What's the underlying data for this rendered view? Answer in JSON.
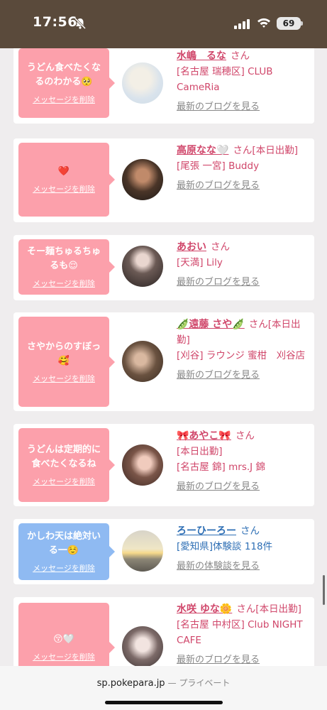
{
  "status_bar": {
    "time": "17:56",
    "battery": "69"
  },
  "cards": [
    {
      "message": "うどん食べたくなるのわかる🥺",
      "delete_label": "メッセージを削除",
      "name": "水嶋　るな",
      "suffix": "さん",
      "shop": "[名古屋 瑞穂区] CLUB CameRia",
      "blog": "最新のブログを見る",
      "bubble_color": "#fca0ab"
    },
    {
      "message": "❤️",
      "delete_label": "メッセージを削除",
      "name": "高原なな🤍",
      "suffix": "さん[本日出勤]",
      "shop": "[尾張 一宮] Buddy",
      "blog": "最新のブログを見る",
      "bubble_color": "#fca0ab"
    },
    {
      "message": "そー麺ちゅるちゅるも😌",
      "delete_label": "メッセージを削除",
      "name": "あおい",
      "suffix": "さん",
      "shop": "[天満] Lily",
      "blog": "最新のブログを見る",
      "bubble_color": "#fca0ab"
    },
    {
      "message": "さやからのすぼっ🥰",
      "delete_label": "メッセージを削除",
      "name": "🫛遠藤 さや🫛",
      "suffix": "さん[本日出勤]",
      "shop": "[刈谷] ラウンジ 蜜柑　刈谷店",
      "blog": "最新のブログを見る",
      "bubble_color": "#fca0ab"
    },
    {
      "message": "うどんは定期的に食べたくなるね",
      "delete_label": "メッセージを削除",
      "name": "🎀あやこ🎀",
      "suffix": "さん",
      "shop": "[本日出勤]",
      "shop2": "[名古屋 錦] mrs.J 錦",
      "blog": "最新のブログを見る",
      "bubble_color": "#fca0ab"
    },
    {
      "message": "かしわ天は絶対いる一☺️",
      "delete_label": "メッセージを削除",
      "name": "ろーひーろー",
      "suffix": "さん",
      "shop": "[愛知県]体験談 118件",
      "blog": "最新の体験談を見る",
      "bubble_color": "#8fbaf2"
    },
    {
      "message": "😚🤍",
      "delete_label": "メッセージを削除",
      "name": "水咲 ゆな🌼",
      "suffix": "さん[本日出勤]",
      "shop": "[名古屋 中村区] Club NIGHT CAFE",
      "blog": "最新のブログを見る",
      "bubble_color": "#fca0ab"
    }
  ],
  "url_bar": {
    "domain": "sp.pokepara.jp",
    "mode": "— プライベート"
  },
  "icons": {
    "bell": "bell-slash-icon",
    "signal": "cellular-signal-icon",
    "wifi": "wifi-icon",
    "battery": "battery-icon"
  }
}
